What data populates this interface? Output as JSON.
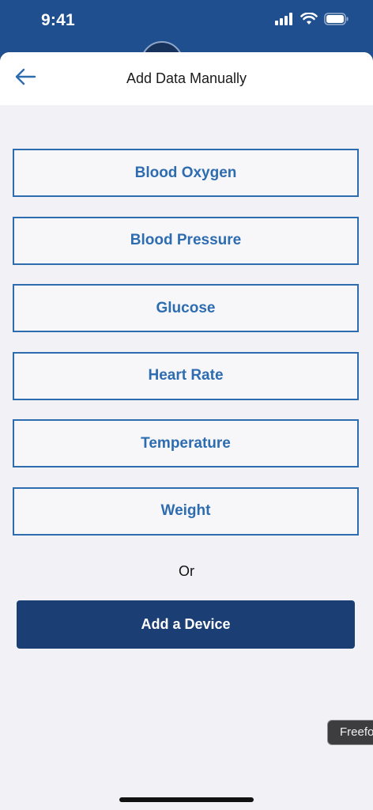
{
  "status_bar": {
    "time": "9:41"
  },
  "header": {
    "title": "Add Data Manually",
    "back_icon": "arrow-left-icon"
  },
  "options": [
    {
      "label": "Blood Oxygen"
    },
    {
      "label": "Blood Pressure"
    },
    {
      "label": "Glucose"
    },
    {
      "label": "Heart Rate"
    },
    {
      "label": "Temperature"
    },
    {
      "label": "Weight"
    }
  ],
  "divider_text": "Or",
  "add_device": {
    "label": "Add a Device"
  },
  "tooltip": {
    "text": "Freefo"
  },
  "colors": {
    "brand_blue": "#1f4f8f",
    "button_outline": "#2e6cb0",
    "primary_button": "#1b3f74",
    "sheet_background": "#f2f1f5"
  }
}
